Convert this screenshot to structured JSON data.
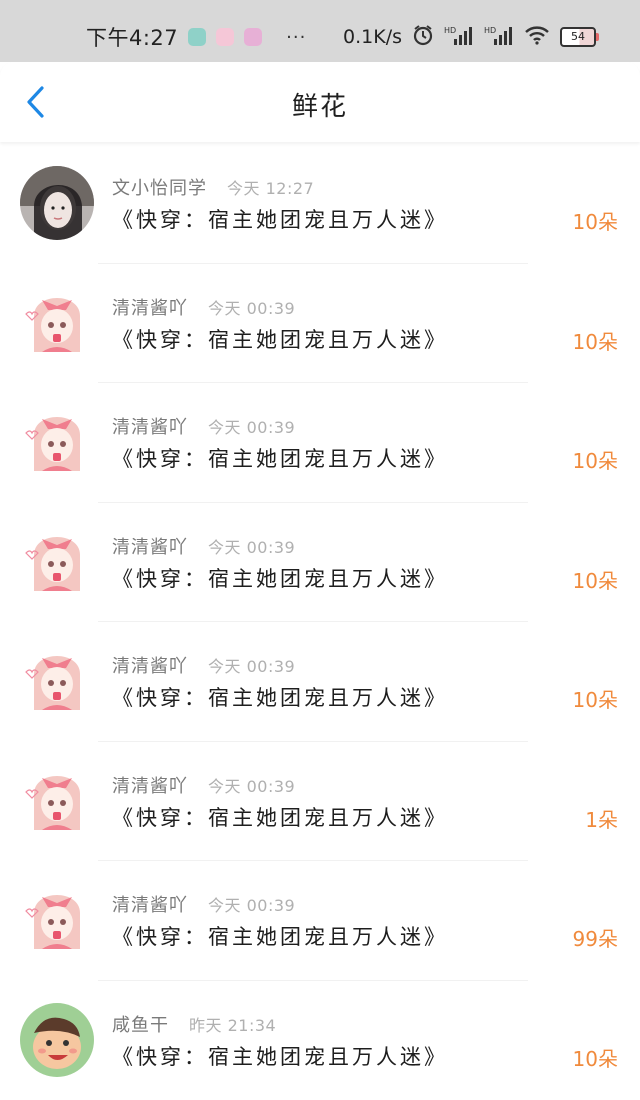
{
  "status_bar": {
    "time": "下午4:27",
    "more": "···",
    "net_speed": "0.1K/s",
    "battery": "54",
    "icons": [
      "app-icon-1",
      "app-icon-2",
      "app-icon-3",
      "alarm-icon",
      "signal-hd-icon",
      "signal-hd-icon",
      "wifi-icon",
      "battery-icon"
    ]
  },
  "header": {
    "title": "鲜花",
    "back_icon": "chevron-left-icon"
  },
  "colors": {
    "accent_back": "#1e88e5",
    "count_orange": "#f08a3c",
    "name_gray": "#7a7a7a",
    "time_gray": "#b0b0b0"
  },
  "items": [
    {
      "name": "文小怡同学",
      "time": "今天 12:27",
      "book": "《快穿：宿主她团宠且万人迷》",
      "count": "10朵",
      "avatar": "photo-girl"
    },
    {
      "name": "清清酱吖",
      "time": "今天 00:39",
      "book": "《快穿：宿主她团宠且万人迷》",
      "count": "10朵",
      "avatar": "anime-girl"
    },
    {
      "name": "清清酱吖",
      "time": "今天 00:39",
      "book": "《快穿：宿主她团宠且万人迷》",
      "count": "10朵",
      "avatar": "anime-girl"
    },
    {
      "name": "清清酱吖",
      "time": "今天 00:39",
      "book": "《快穿：宿主她团宠且万人迷》",
      "count": "10朵",
      "avatar": "anime-girl"
    },
    {
      "name": "清清酱吖",
      "time": "今天 00:39",
      "book": "《快穿：宿主她团宠且万人迷》",
      "count": "10朵",
      "avatar": "anime-girl"
    },
    {
      "name": "清清酱吖",
      "time": "今天 00:39",
      "book": "《快穿：宿主她团宠且万人迷》",
      "count": "1朵",
      "avatar": "anime-girl"
    },
    {
      "name": "清清酱吖",
      "time": "今天 00:39",
      "book": "《快穿：宿主她团宠且万人迷》",
      "count": "99朵",
      "avatar": "anime-girl"
    },
    {
      "name": "咸鱼干",
      "time": "昨天 21:34",
      "book": "《快穿：宿主她团宠且万人迷》",
      "count": "10朵",
      "avatar": "cartoon-boy"
    }
  ]
}
